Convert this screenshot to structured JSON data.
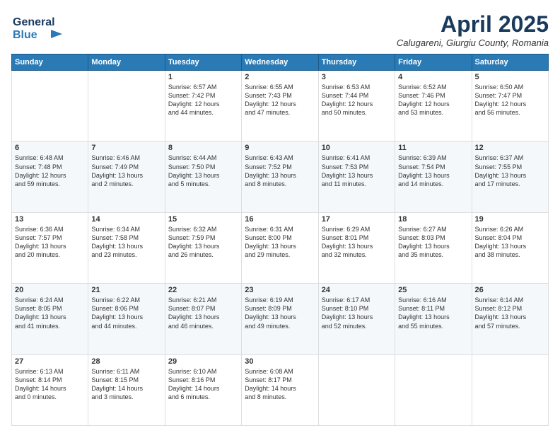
{
  "header": {
    "logo_line1": "General",
    "logo_line2": "Blue",
    "month_title": "April 2025",
    "location": "Calugareni, Giurgiu County, Romania"
  },
  "days_of_week": [
    "Sunday",
    "Monday",
    "Tuesday",
    "Wednesday",
    "Thursday",
    "Friday",
    "Saturday"
  ],
  "weeks": [
    [
      {
        "day": "",
        "content": ""
      },
      {
        "day": "",
        "content": ""
      },
      {
        "day": "1",
        "content": "Sunrise: 6:57 AM\nSunset: 7:42 PM\nDaylight: 12 hours\nand 44 minutes."
      },
      {
        "day": "2",
        "content": "Sunrise: 6:55 AM\nSunset: 7:43 PM\nDaylight: 12 hours\nand 47 minutes."
      },
      {
        "day": "3",
        "content": "Sunrise: 6:53 AM\nSunset: 7:44 PM\nDaylight: 12 hours\nand 50 minutes."
      },
      {
        "day": "4",
        "content": "Sunrise: 6:52 AM\nSunset: 7:46 PM\nDaylight: 12 hours\nand 53 minutes."
      },
      {
        "day": "5",
        "content": "Sunrise: 6:50 AM\nSunset: 7:47 PM\nDaylight: 12 hours\nand 56 minutes."
      }
    ],
    [
      {
        "day": "6",
        "content": "Sunrise: 6:48 AM\nSunset: 7:48 PM\nDaylight: 12 hours\nand 59 minutes."
      },
      {
        "day": "7",
        "content": "Sunrise: 6:46 AM\nSunset: 7:49 PM\nDaylight: 13 hours\nand 2 minutes."
      },
      {
        "day": "8",
        "content": "Sunrise: 6:44 AM\nSunset: 7:50 PM\nDaylight: 13 hours\nand 5 minutes."
      },
      {
        "day": "9",
        "content": "Sunrise: 6:43 AM\nSunset: 7:52 PM\nDaylight: 13 hours\nand 8 minutes."
      },
      {
        "day": "10",
        "content": "Sunrise: 6:41 AM\nSunset: 7:53 PM\nDaylight: 13 hours\nand 11 minutes."
      },
      {
        "day": "11",
        "content": "Sunrise: 6:39 AM\nSunset: 7:54 PM\nDaylight: 13 hours\nand 14 minutes."
      },
      {
        "day": "12",
        "content": "Sunrise: 6:37 AM\nSunset: 7:55 PM\nDaylight: 13 hours\nand 17 minutes."
      }
    ],
    [
      {
        "day": "13",
        "content": "Sunrise: 6:36 AM\nSunset: 7:57 PM\nDaylight: 13 hours\nand 20 minutes."
      },
      {
        "day": "14",
        "content": "Sunrise: 6:34 AM\nSunset: 7:58 PM\nDaylight: 13 hours\nand 23 minutes."
      },
      {
        "day": "15",
        "content": "Sunrise: 6:32 AM\nSunset: 7:59 PM\nDaylight: 13 hours\nand 26 minutes."
      },
      {
        "day": "16",
        "content": "Sunrise: 6:31 AM\nSunset: 8:00 PM\nDaylight: 13 hours\nand 29 minutes."
      },
      {
        "day": "17",
        "content": "Sunrise: 6:29 AM\nSunset: 8:01 PM\nDaylight: 13 hours\nand 32 minutes."
      },
      {
        "day": "18",
        "content": "Sunrise: 6:27 AM\nSunset: 8:03 PM\nDaylight: 13 hours\nand 35 minutes."
      },
      {
        "day": "19",
        "content": "Sunrise: 6:26 AM\nSunset: 8:04 PM\nDaylight: 13 hours\nand 38 minutes."
      }
    ],
    [
      {
        "day": "20",
        "content": "Sunrise: 6:24 AM\nSunset: 8:05 PM\nDaylight: 13 hours\nand 41 minutes."
      },
      {
        "day": "21",
        "content": "Sunrise: 6:22 AM\nSunset: 8:06 PM\nDaylight: 13 hours\nand 44 minutes."
      },
      {
        "day": "22",
        "content": "Sunrise: 6:21 AM\nSunset: 8:07 PM\nDaylight: 13 hours\nand 46 minutes."
      },
      {
        "day": "23",
        "content": "Sunrise: 6:19 AM\nSunset: 8:09 PM\nDaylight: 13 hours\nand 49 minutes."
      },
      {
        "day": "24",
        "content": "Sunrise: 6:17 AM\nSunset: 8:10 PM\nDaylight: 13 hours\nand 52 minutes."
      },
      {
        "day": "25",
        "content": "Sunrise: 6:16 AM\nSunset: 8:11 PM\nDaylight: 13 hours\nand 55 minutes."
      },
      {
        "day": "26",
        "content": "Sunrise: 6:14 AM\nSunset: 8:12 PM\nDaylight: 13 hours\nand 57 minutes."
      }
    ],
    [
      {
        "day": "27",
        "content": "Sunrise: 6:13 AM\nSunset: 8:14 PM\nDaylight: 14 hours\nand 0 minutes."
      },
      {
        "day": "28",
        "content": "Sunrise: 6:11 AM\nSunset: 8:15 PM\nDaylight: 14 hours\nand 3 minutes."
      },
      {
        "day": "29",
        "content": "Sunrise: 6:10 AM\nSunset: 8:16 PM\nDaylight: 14 hours\nand 6 minutes."
      },
      {
        "day": "30",
        "content": "Sunrise: 6:08 AM\nSunset: 8:17 PM\nDaylight: 14 hours\nand 8 minutes."
      },
      {
        "day": "",
        "content": ""
      },
      {
        "day": "",
        "content": ""
      },
      {
        "day": "",
        "content": ""
      }
    ]
  ]
}
